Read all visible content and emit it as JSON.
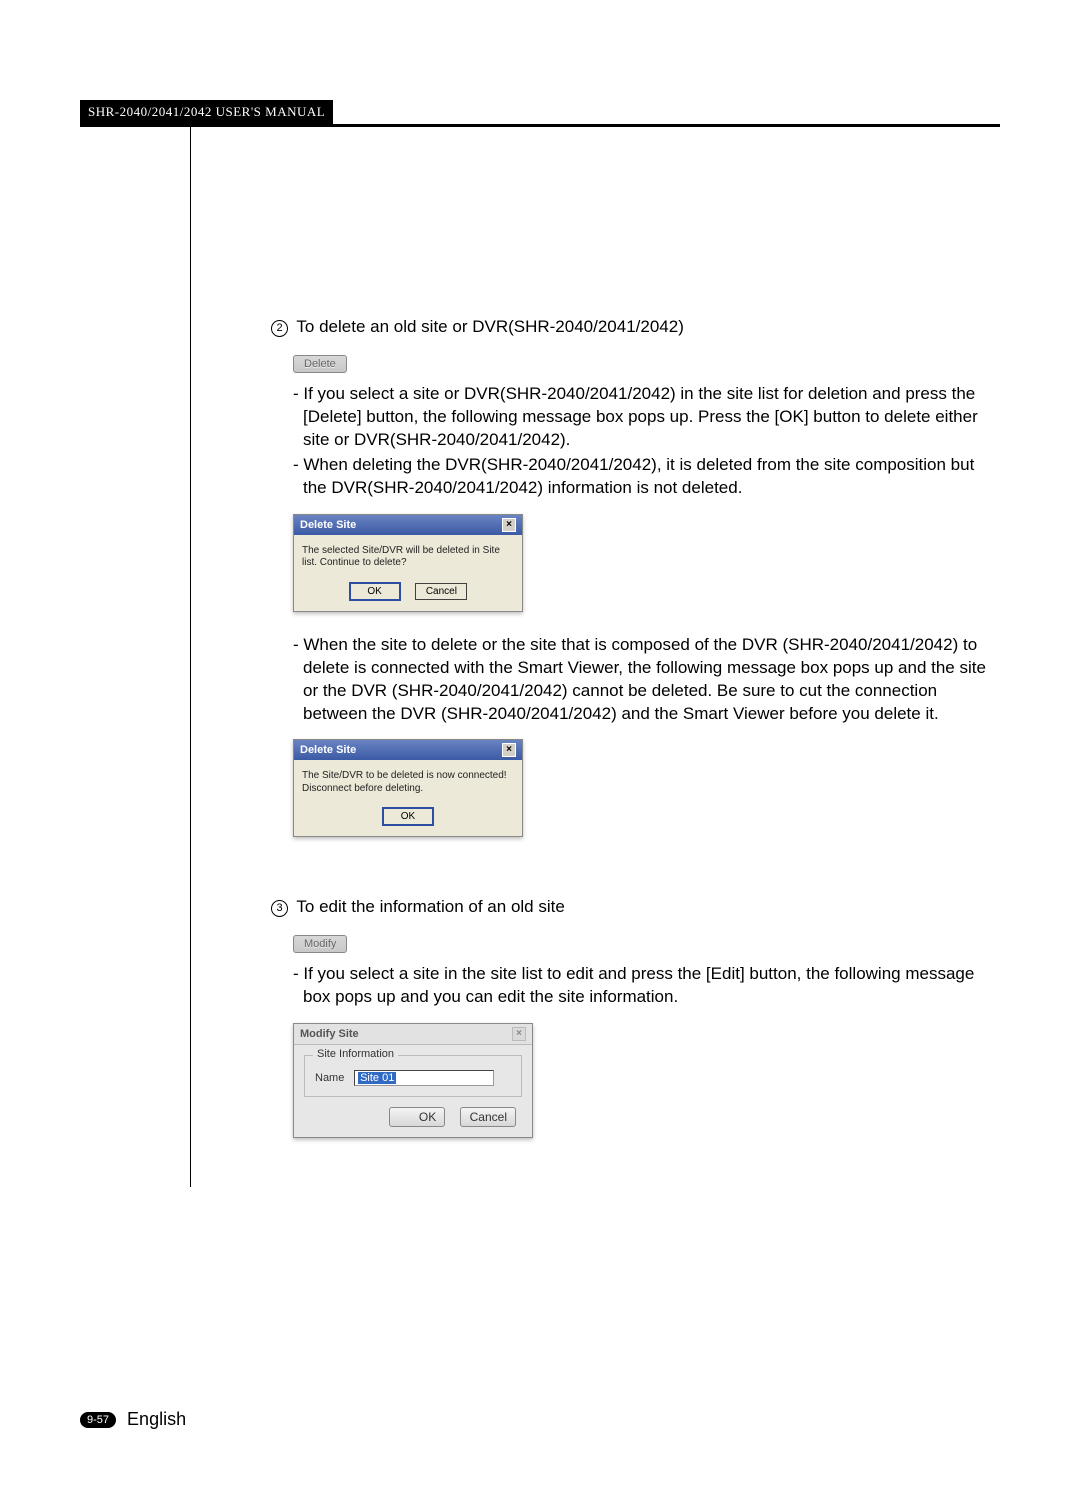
{
  "header": {
    "manual_title": "SHR-2040/2041/2042 USER'S MANUAL"
  },
  "step2": {
    "num": "2",
    "title": "To delete an old site or DVR(SHR-2040/2041/2042)",
    "button_label": "Delete",
    "para1": "- If you select a site or DVR(SHR-2040/2041/2042) in the site list for deletion and press the [Delete] button, the following message box pops up. Press the [OK] button to delete either site or DVR(SHR-2040/2041/2042).",
    "para2": "- When deleting the DVR(SHR-2040/2041/2042), it is deleted from the site composition but the DVR(SHR-2040/2041/2042) information is not deleted.",
    "dialog1": {
      "title": "Delete Site",
      "msg": "The selected Site/DVR will be deleted in Site list. Continue to delete?",
      "ok": "OK",
      "cancel": "Cancel"
    },
    "para3": "- When the site to delete or the site that is composed of the DVR (SHR-2040/2041/2042) to delete is connected with the Smart Viewer, the following message box pops up and the site or the DVR (SHR-2040/2041/2042) cannot be deleted. Be sure to cut the connection between the DVR  (SHR-2040/2041/2042) and the Smart Viewer before you delete it.",
    "dialog2": {
      "title": "Delete Site",
      "msg": "The Site/DVR to be deleted is now connected! Disconnect before deleting.",
      "ok": "OK"
    }
  },
  "step3": {
    "num": "3",
    "title": "To edit the information of an old site",
    "button_label": "Modify",
    "para1": "- If you select a site in the site list to edit and press the [Edit] button, the following message box pops up and you can edit the site information.",
    "dialog": {
      "title": "Modify Site",
      "group": "Site Information",
      "name_label": "Name",
      "name_value": "Site 01",
      "ok": "OK",
      "cancel": "Cancel"
    }
  },
  "footer": {
    "page": "9-57",
    "lang": "English"
  }
}
